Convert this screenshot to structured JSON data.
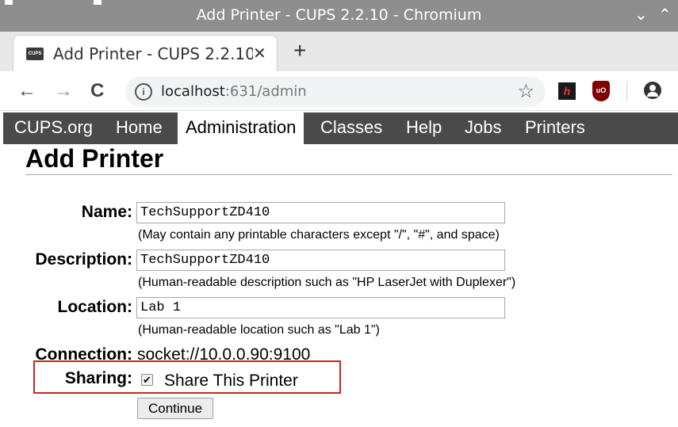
{
  "window": {
    "title": "Add Printer - CUPS 2.2.10 - Chromium",
    "controls": [
      "⌄",
      "⌃"
    ]
  },
  "tab": {
    "favicon_text": "CUPS",
    "title": "Add Printer - CUPS 2.2.10",
    "close": "✕",
    "new_tab": "+"
  },
  "toolbar": {
    "back": "←",
    "forward": "→",
    "reload": "C",
    "url_host": "localhost",
    "url_path": ":631/admin",
    "star": "☆",
    "ext1_text": "h",
    "ext2_text": "uO"
  },
  "cups_nav": {
    "items": [
      "CUPS.org",
      "Home",
      "Administration",
      "Classes",
      "Help",
      "Jobs",
      "Printers"
    ],
    "active": "Administration"
  },
  "page": {
    "title": "Add Printer",
    "form": {
      "name_label": "Name:",
      "name_value": "TechSupportZD410",
      "name_hint": "(May contain any printable characters except \"/\", \"#\", and space)",
      "description_label": "Description:",
      "description_value": "TechSupportZD410",
      "description_hint": "(Human-readable description such as \"HP LaserJet with Duplexer\")",
      "location_label": "Location:",
      "location_value": "Lab 1",
      "location_hint": "(Human-readable location such as \"Lab 1\")",
      "connection_label": "Connection:",
      "connection_value": "socket://10.0.0.90:9100",
      "sharing_label": "Sharing:",
      "sharing_checkbox_label": "Share This Printer",
      "sharing_checked": true,
      "continue_label": "Continue"
    }
  },
  "colors": {
    "highlight": "#c62828",
    "cups_nav_bg": "#4a4a4a",
    "title_bar_bg": "#8e8e8e"
  }
}
